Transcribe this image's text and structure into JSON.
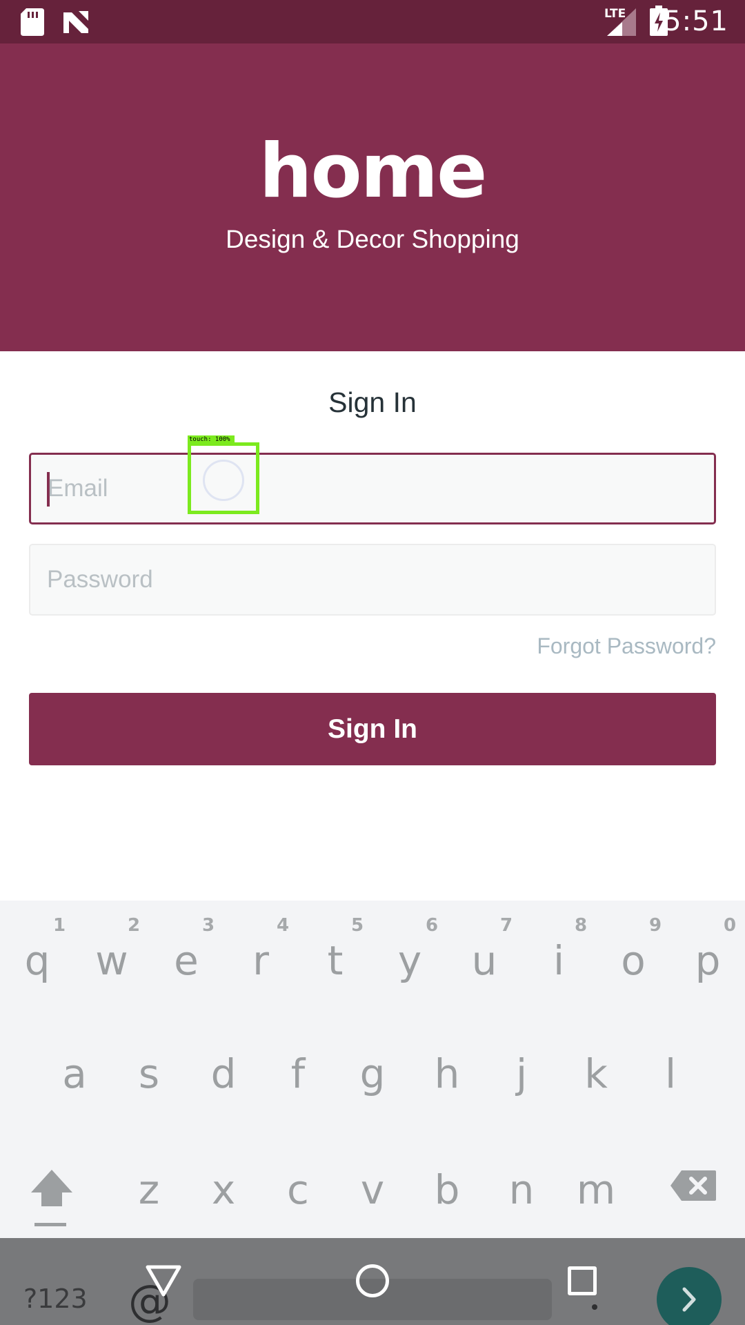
{
  "status_bar": {
    "time": "5:51",
    "network_label": "LTE",
    "icons": [
      "sd-card-icon",
      "n-notification-icon",
      "lte-signal-icon",
      "battery-charging-icon"
    ]
  },
  "header": {
    "logo_text": "home",
    "tagline": "Design & Decor Shopping",
    "background_color": "#842e4f"
  },
  "form": {
    "title": "Sign In",
    "email_placeholder": "Email",
    "password_placeholder": "Password",
    "forgot_password": "Forgot Password?",
    "submit_label": "Sign In",
    "accent_color": "#842e4f"
  },
  "touch_overlay": {
    "label": "touch: 100%",
    "color": "#7cea1e"
  },
  "keyboard": {
    "row1": [
      "q",
      "w",
      "e",
      "r",
      "t",
      "y",
      "u",
      "i",
      "o",
      "p"
    ],
    "row1_hints": [
      "1",
      "2",
      "3",
      "4",
      "5",
      "6",
      "7",
      "8",
      "9",
      "0"
    ],
    "row2": [
      "a",
      "s",
      "d",
      "f",
      "g",
      "h",
      "j",
      "k",
      "l"
    ],
    "row3": [
      "z",
      "x",
      "c",
      "v",
      "b",
      "n",
      "m"
    ],
    "symbols_label": "?123",
    "at_label": "@",
    "dot_label": "."
  }
}
